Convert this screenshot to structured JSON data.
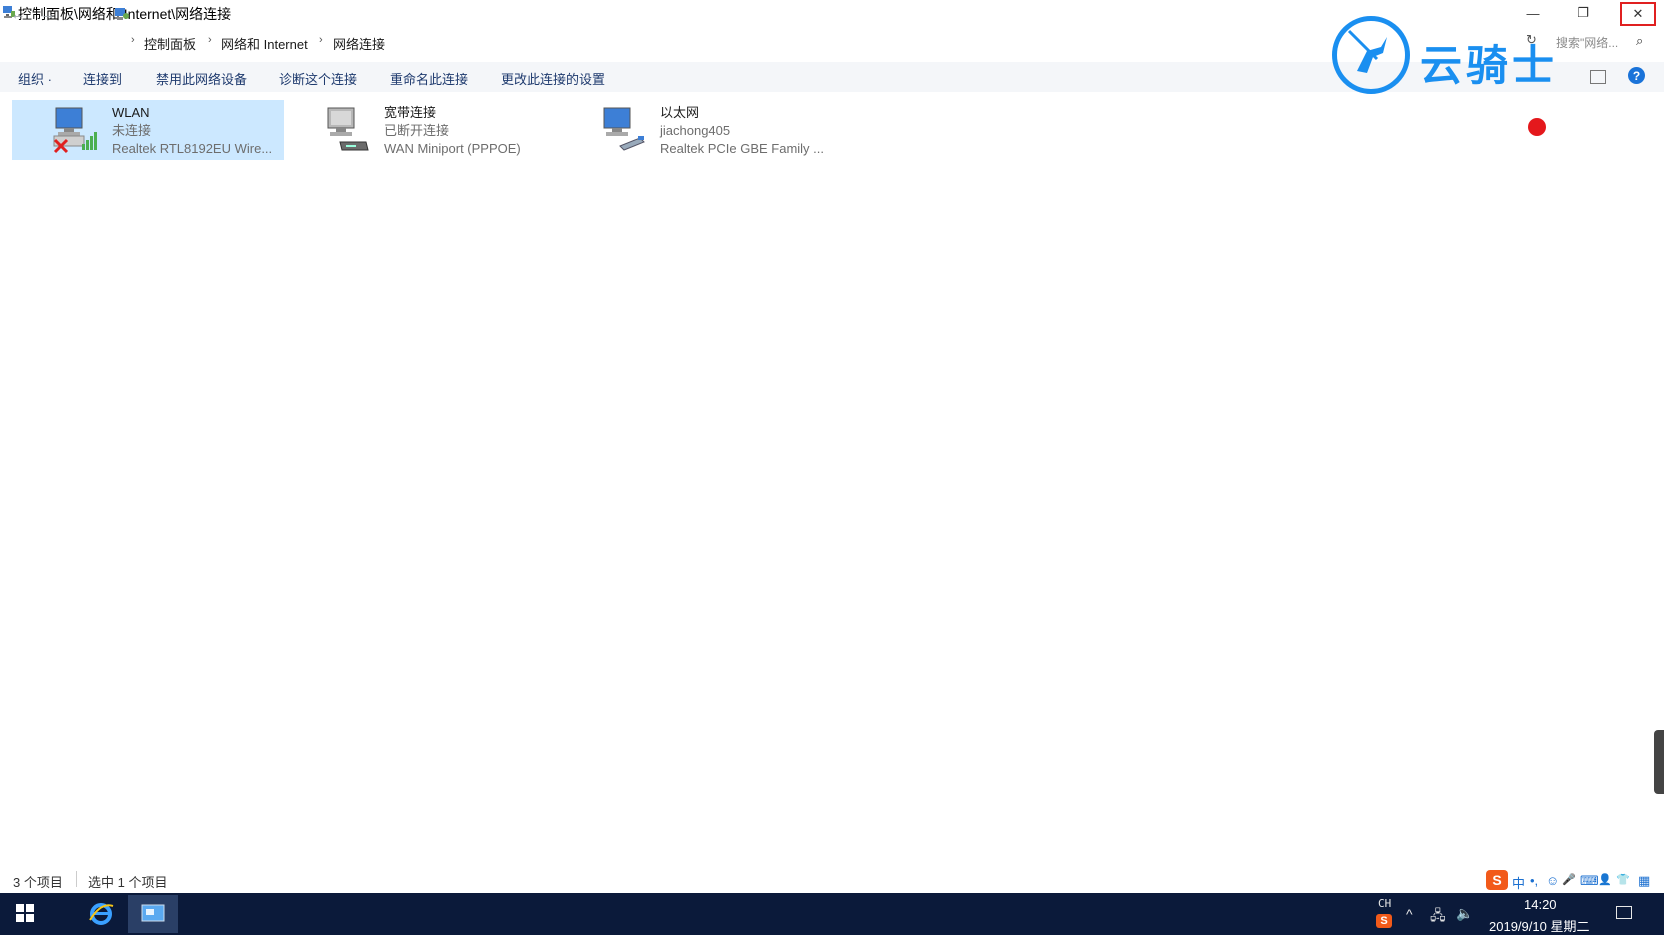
{
  "window": {
    "title": "控制面板\\网络和 Internet\\网络连接",
    "minimize_symbol": "—",
    "maximize_symbol": "❐",
    "close_symbol": "✕"
  },
  "address": {
    "back_symbol": "←",
    "forward_symbol": "→",
    "dropdown_symbol": "⌄",
    "up_symbol": "↑",
    "breadcrumbs": [
      "控制面板",
      "网络和 Internet",
      "网络连接"
    ],
    "separator": "›",
    "search_placeholder": "搜索\"网络...",
    "search_symbol": "⌕",
    "refresh_symbol": "↻"
  },
  "toolbar": {
    "items": [
      {
        "label": "组织 ·"
      },
      {
        "label": "连接到"
      },
      {
        "label": "禁用此网络设备"
      },
      {
        "label": "诊断这个连接"
      },
      {
        "label": "重命名此连接"
      },
      {
        "label": "更改此连接的设置"
      }
    ],
    "help_symbol": "?"
  },
  "watermark": {
    "text": "云骑士"
  },
  "connections": [
    {
      "name": "WLAN",
      "status": "未连接",
      "device": "Realtek RTL8192EU Wire...",
      "icon": "wireless-adapter-icon",
      "selected": true
    },
    {
      "name": "宽带连接",
      "status": "已断开连接",
      "device": "WAN Miniport (PPPOE)",
      "icon": "broadband-modem-icon",
      "selected": false
    },
    {
      "name": "以太网",
      "status": "jiachong405",
      "device": "Realtek PCIe GBE Family ...",
      "icon": "ethernet-adapter-icon",
      "selected": false
    }
  ],
  "statusbar": {
    "item_count": "3 个项目",
    "selected_count": "选中 1 个项目"
  },
  "ime": {
    "logo": "S",
    "mode": "中",
    "punct": "•,",
    "emoji": "☺",
    "mic": "🎤",
    "keyboard": "⌨",
    "user": "👤",
    "skin": "👕",
    "menu": "▦"
  },
  "taskbar": {
    "tray_lang": "CH",
    "tray_ime": "S",
    "tray_up": "^",
    "tray_network": "🖧",
    "tray_volume": "🔈",
    "time": "14:20",
    "date": "2019/9/10 星期二"
  },
  "colors": {
    "selected_bg": "#cce8ff",
    "accent": "#1a8ff0",
    "taskbar_bg": "#0b1a3a",
    "close_highlight": "#e02020"
  }
}
